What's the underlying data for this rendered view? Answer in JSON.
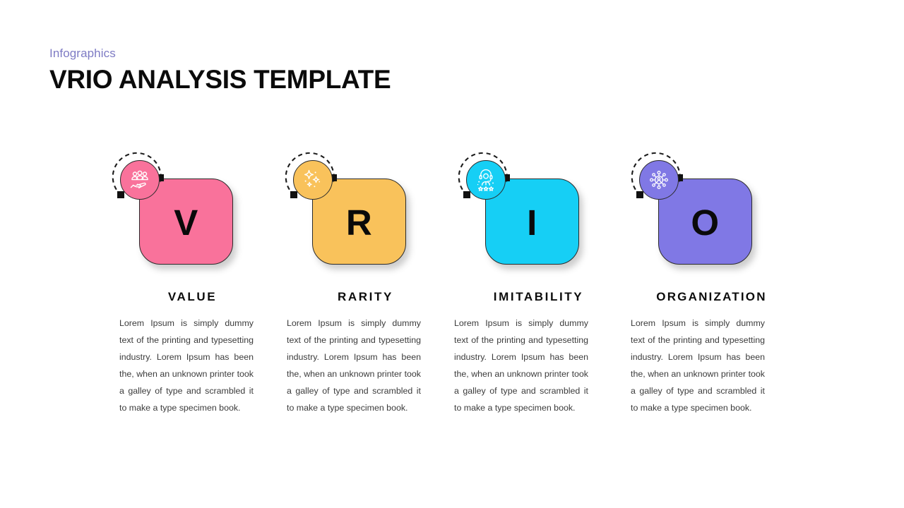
{
  "header": {
    "eyebrow": "Infographics",
    "title": "VRIO ANALYSIS TEMPLATE",
    "eyebrow_color": "#7e7bc4"
  },
  "shared": {
    "body_text": "Lorem Ipsum is simply dummy text of the printing and typesetting industry. Lorem Ipsum has been the, when an unknown printer took a galley of type and scrambled it to make a type specimen book."
  },
  "columns": [
    {
      "letter": "V",
      "heading": "VALUE",
      "color": "#f9729b",
      "icon": "people-in-hand-icon",
      "body": "Lorem Ipsum is simply dummy text of the printing and typesetting industry. Lorem Ipsum has been the, when an unknown printer took a galley of type and scrambled it to make a type specimen book."
    },
    {
      "letter": "R",
      "heading": "RARITY",
      "color": "#f9c25b",
      "icon": "sparkles-icon",
      "body": "Lorem Ipsum is simply dummy text of the printing and typesetting industry. Lorem Ipsum has been the, when an unknown printer took a galley of type and scrambled it to make a type specimen book."
    },
    {
      "letter": "I",
      "heading": "IMITABILITY",
      "color": "#16cff5",
      "icon": "headset-agent-rating-icon",
      "body": "Lorem Ipsum is simply dummy text of the printing and typesetting industry. Lorem Ipsum has been the, when an unknown printer took a galley of type and scrambled it to make a type specimen book."
    },
    {
      "letter": "O",
      "heading": "ORGANIZATION",
      "color": "#8078e5",
      "icon": "network-hub-person-icon",
      "body": "Lorem Ipsum is simply dummy text of the printing and typesetting industry. Lorem Ipsum has been the, when an unknown printer took a galley of type and scrambled it to make a type specimen book."
    }
  ]
}
